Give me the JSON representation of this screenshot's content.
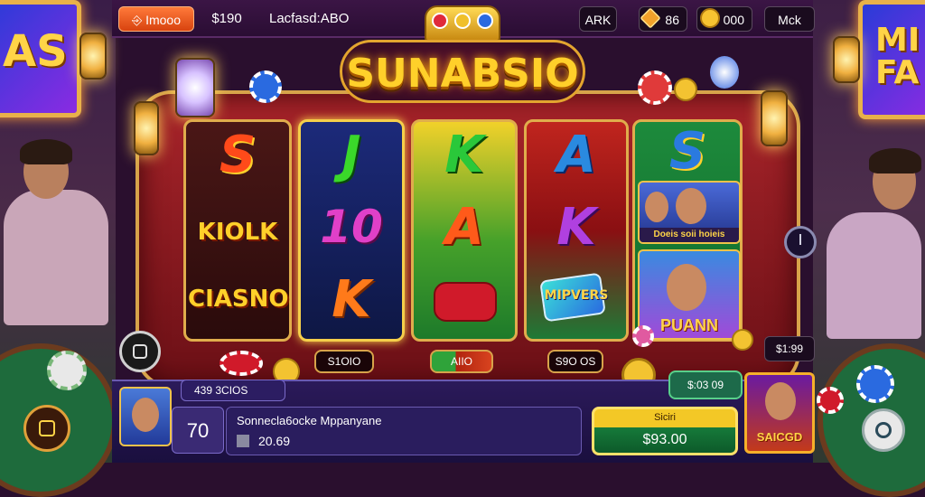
{
  "topbar": {
    "promo_label": "Imooo",
    "value": "$190",
    "title": "Lacfasd:ABO",
    "btn_a": "ARK",
    "gems": "86",
    "coins": "000",
    "menu": "Mck"
  },
  "game": {
    "logo": "SUNABSIO",
    "signs": {
      "left": "AS",
      "right": "MI FA"
    },
    "reels": [
      {
        "symbols": [
          "S",
          "KIOLK",
          "CIASNO"
        ]
      },
      {
        "symbols": [
          "J",
          "10",
          "K"
        ]
      },
      {
        "symbols": [
          "K",
          "A",
          ""
        ]
      },
      {
        "symbols": [
          "A",
          "K",
          "MIPVERS"
        ]
      },
      {
        "symbols": [
          "S",
          "Doeis soii hoieis",
          "PUANN"
        ]
      }
    ],
    "bets": {
      "left": "S1OIO",
      "mid": "AIIO",
      "right": "S9O OS"
    },
    "side_value": "$1:99"
  },
  "bottom": {
    "level_tag": "439 3CIOS",
    "level": "70",
    "chat_name": "Sonnecla6ocke Mppanyane",
    "chat_amount": "20.69",
    "balance": "$:03 09",
    "spin_label": "Siciri",
    "spin_amount": "$93.00",
    "promo_card": "SAICGD"
  },
  "colors": {
    "accent_orange": "#d8430f",
    "gold": "#f3c826",
    "green": "#167a3a",
    "panel": "#2b1a5a"
  }
}
